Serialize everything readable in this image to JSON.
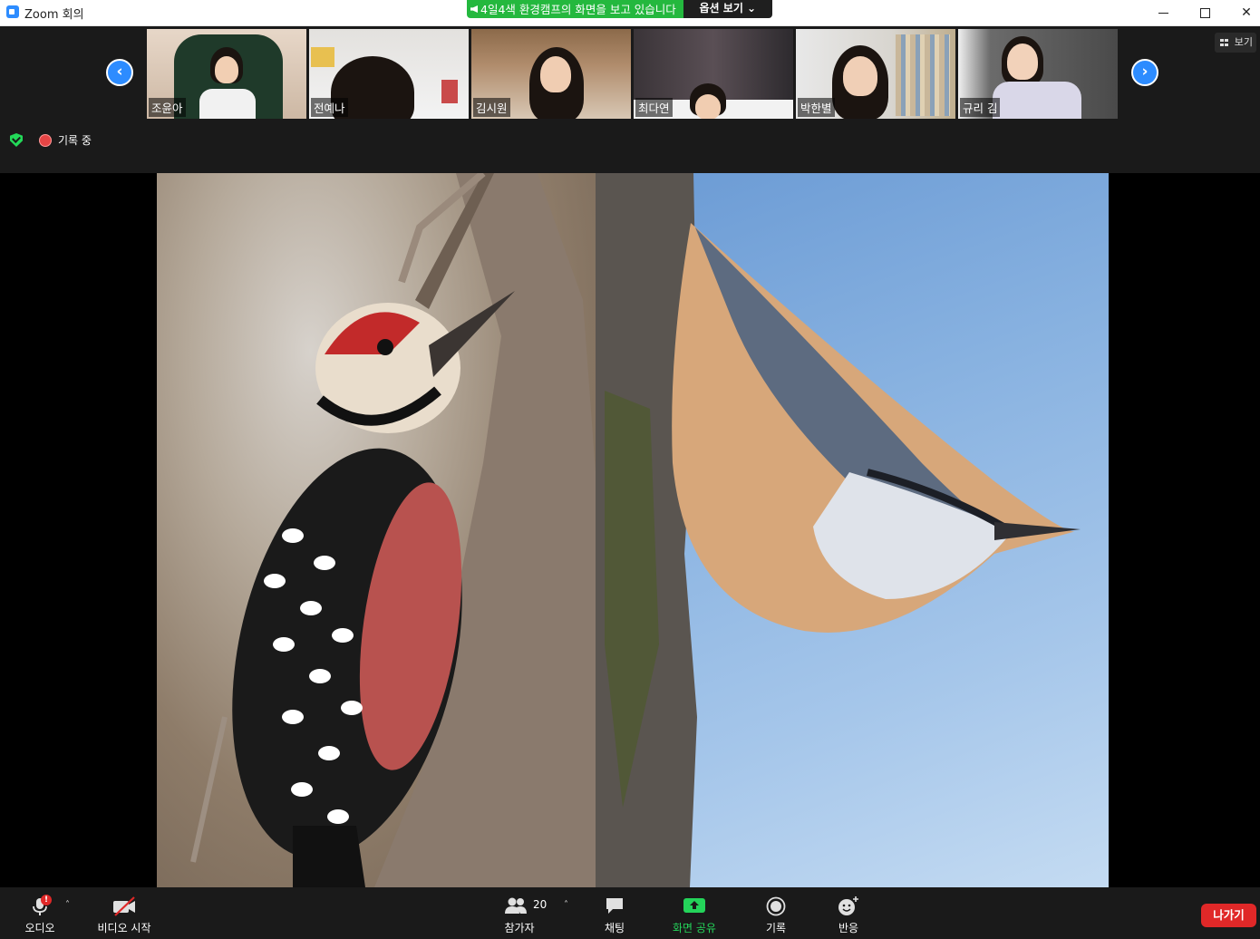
{
  "window": {
    "title": "Zoom 회의",
    "minimize": "",
    "maximize": "",
    "close": "✕"
  },
  "share_banner": {
    "message": "4일4색 환경캠프의 화면을 보고 있습니다",
    "options_label": "옵션 보기 ⌄"
  },
  "gallery": {
    "prev_arrow": "‹",
    "next_arrow": "›",
    "view_label": "보기",
    "participants": [
      {
        "name": "조윤아"
      },
      {
        "name": "전예나"
      },
      {
        "name": "김시원"
      },
      {
        "name": "최다연"
      },
      {
        "name": "박한별"
      },
      {
        "name": "규리 김"
      }
    ]
  },
  "status": {
    "recording_label": "기록 중"
  },
  "controls": {
    "audio_label": "오디오",
    "audio_alert": "!",
    "video_label": "비디오 시작",
    "participants_label": "참가자",
    "participants_count": "20",
    "chat_label": "채팅",
    "share_label": "화면 공유",
    "record_label": "기록",
    "reactions_label": "반응",
    "leave_label": "나가기",
    "caret": "˄"
  },
  "colors": {
    "accent_blue": "#2d8cff",
    "share_green": "#24b83e",
    "leave_red": "#e02828",
    "recording_red": "#e64545"
  }
}
